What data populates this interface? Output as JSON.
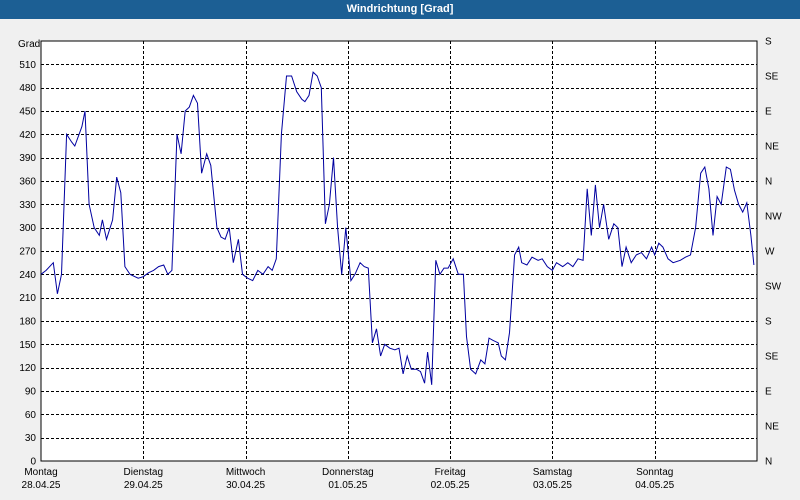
{
  "window": {
    "title": "Windrichtung [Grad]"
  },
  "chart_data": {
    "type": "line",
    "title": "Windrichtung [Grad]",
    "ylabel": "Grad",
    "ylim": [
      0,
      540
    ],
    "y_ticks": [
      0,
      30,
      60,
      90,
      120,
      150,
      180,
      210,
      240,
      270,
      300,
      330,
      360,
      390,
      420,
      450,
      480,
      510
    ],
    "right_ticks": [
      "N",
      "NE",
      "E",
      "SE",
      "S",
      "SW",
      "W",
      "NW",
      "N",
      "NE",
      "E",
      "SE",
      "S"
    ],
    "x_ticks": [
      {
        "day": "Montag",
        "date": "28.04.25"
      },
      {
        "day": "Dienstag",
        "date": "29.04.25"
      },
      {
        "day": "Mittwoch",
        "date": "30.04.25"
      },
      {
        "day": "Donnerstag",
        "date": "01.05.25"
      },
      {
        "day": "Freitag",
        "date": "02.05.25"
      },
      {
        "day": "Samstag",
        "date": "03.05.25"
      },
      {
        "day": "Sonntag",
        "date": "04.05.25"
      }
    ],
    "xlim_days": [
      0,
      7
    ],
    "grid": true,
    "colors": {
      "line": "#0000a0",
      "grid": "#000000",
      "titlebar": "#1c5f94"
    },
    "series": [
      {
        "values": [
          [
            0,
            240
          ],
          [
            0.05,
            245
          ],
          [
            0.12,
            255
          ],
          [
            0.16,
            215
          ],
          [
            0.2,
            240
          ],
          [
            0.25,
            420
          ],
          [
            0.3,
            410
          ],
          [
            0.33,
            405
          ],
          [
            0.4,
            430
          ],
          [
            0.43,
            450
          ],
          [
            0.47,
            330
          ],
          [
            0.52,
            300
          ],
          [
            0.57,
            290
          ],
          [
            0.6,
            310
          ],
          [
            0.64,
            285
          ],
          [
            0.7,
            310
          ],
          [
            0.74,
            365
          ],
          [
            0.78,
            345
          ],
          [
            0.82,
            250
          ],
          [
            0.87,
            240
          ],
          [
            0.95,
            235
          ],
          [
            1.0,
            237
          ],
          [
            1.05,
            242
          ],
          [
            1.1,
            245
          ],
          [
            1.15,
            250
          ],
          [
            1.2,
            252
          ],
          [
            1.24,
            240
          ],
          [
            1.28,
            245
          ],
          [
            1.33,
            420
          ],
          [
            1.37,
            395
          ],
          [
            1.41,
            450
          ],
          [
            1.45,
            455
          ],
          [
            1.49,
            470
          ],
          [
            1.53,
            460
          ],
          [
            1.57,
            370
          ],
          [
            1.62,
            395
          ],
          [
            1.66,
            380
          ],
          [
            1.72,
            300
          ],
          [
            1.76,
            288
          ],
          [
            1.8,
            285
          ],
          [
            1.84,
            300
          ],
          [
            1.88,
            255
          ],
          [
            1.93,
            285
          ],
          [
            1.97,
            240
          ],
          [
            2.02,
            235
          ],
          [
            2.07,
            232
          ],
          [
            2.12,
            245
          ],
          [
            2.17,
            240
          ],
          [
            2.22,
            250
          ],
          [
            2.26,
            245
          ],
          [
            2.3,
            260
          ],
          [
            2.35,
            420
          ],
          [
            2.4,
            495
          ],
          [
            2.45,
            495
          ],
          [
            2.5,
            475
          ],
          [
            2.55,
            465
          ],
          [
            2.58,
            462
          ],
          [
            2.62,
            470
          ],
          [
            2.66,
            500
          ],
          [
            2.7,
            495
          ],
          [
            2.74,
            480
          ],
          [
            2.78,
            305
          ],
          [
            2.82,
            330
          ],
          [
            2.86,
            390
          ],
          [
            2.9,
            300
          ],
          [
            2.94,
            240
          ],
          [
            2.98,
            300
          ],
          [
            3.03,
            232
          ],
          [
            3.07,
            240
          ],
          [
            3.12,
            255
          ],
          [
            3.16,
            250
          ],
          [
            3.2,
            248
          ],
          [
            3.24,
            152
          ],
          [
            3.28,
            170
          ],
          [
            3.32,
            135
          ],
          [
            3.36,
            150
          ],
          [
            3.41,
            145
          ],
          [
            3.46,
            143
          ],
          [
            3.5,
            145
          ],
          [
            3.54,
            112
          ],
          [
            3.58,
            135
          ],
          [
            3.62,
            118
          ],
          [
            3.67,
            118
          ],
          [
            3.71,
            115
          ],
          [
            3.75,
            100
          ],
          [
            3.78,
            140
          ],
          [
            3.82,
            98
          ],
          [
            3.86,
            258
          ],
          [
            3.9,
            240
          ],
          [
            3.94,
            248
          ],
          [
            3.98,
            248
          ],
          [
            4.03,
            260
          ],
          [
            4.08,
            240
          ],
          [
            4.13,
            240
          ],
          [
            4.16,
            160
          ],
          [
            4.2,
            118
          ],
          [
            4.25,
            112
          ],
          [
            4.3,
            130
          ],
          [
            4.34,
            125
          ],
          [
            4.38,
            158
          ],
          [
            4.42,
            155
          ],
          [
            4.47,
            152
          ],
          [
            4.5,
            135
          ],
          [
            4.54,
            130
          ],
          [
            4.58,
            165
          ],
          [
            4.63,
            265
          ],
          [
            4.67,
            275
          ],
          [
            4.7,
            255
          ],
          [
            4.75,
            252
          ],
          [
            4.8,
            262
          ],
          [
            4.86,
            258
          ],
          [
            4.9,
            260
          ],
          [
            4.95,
            250
          ],
          [
            5.0,
            245
          ],
          [
            5.04,
            255
          ],
          [
            5.1,
            250
          ],
          [
            5.15,
            255
          ],
          [
            5.2,
            250
          ],
          [
            5.25,
            260
          ],
          [
            5.3,
            258
          ],
          [
            5.34,
            350
          ],
          [
            5.38,
            290
          ],
          [
            5.42,
            355
          ],
          [
            5.46,
            300
          ],
          [
            5.5,
            330
          ],
          [
            5.55,
            285
          ],
          [
            5.6,
            305
          ],
          [
            5.64,
            300
          ],
          [
            5.68,
            250
          ],
          [
            5.72,
            275
          ],
          [
            5.77,
            255
          ],
          [
            5.82,
            265
          ],
          [
            5.87,
            268
          ],
          [
            5.92,
            260
          ],
          [
            5.97,
            275
          ],
          [
            6.0,
            265
          ],
          [
            6.04,
            280
          ],
          [
            6.08,
            275
          ],
          [
            6.13,
            260
          ],
          [
            6.18,
            255
          ],
          [
            6.25,
            258
          ],
          [
            6.3,
            262
          ],
          [
            6.35,
            265
          ],
          [
            6.4,
            300
          ],
          [
            6.45,
            370
          ],
          [
            6.49,
            378
          ],
          [
            6.53,
            350
          ],
          [
            6.57,
            290
          ],
          [
            6.61,
            340
          ],
          [
            6.65,
            330
          ],
          [
            6.7,
            378
          ],
          [
            6.74,
            375
          ],
          [
            6.78,
            348
          ],
          [
            6.82,
            330
          ],
          [
            6.86,
            320
          ],
          [
            6.9,
            332
          ],
          [
            6.94,
            290
          ],
          [
            6.97,
            252
          ]
        ]
      }
    ]
  }
}
